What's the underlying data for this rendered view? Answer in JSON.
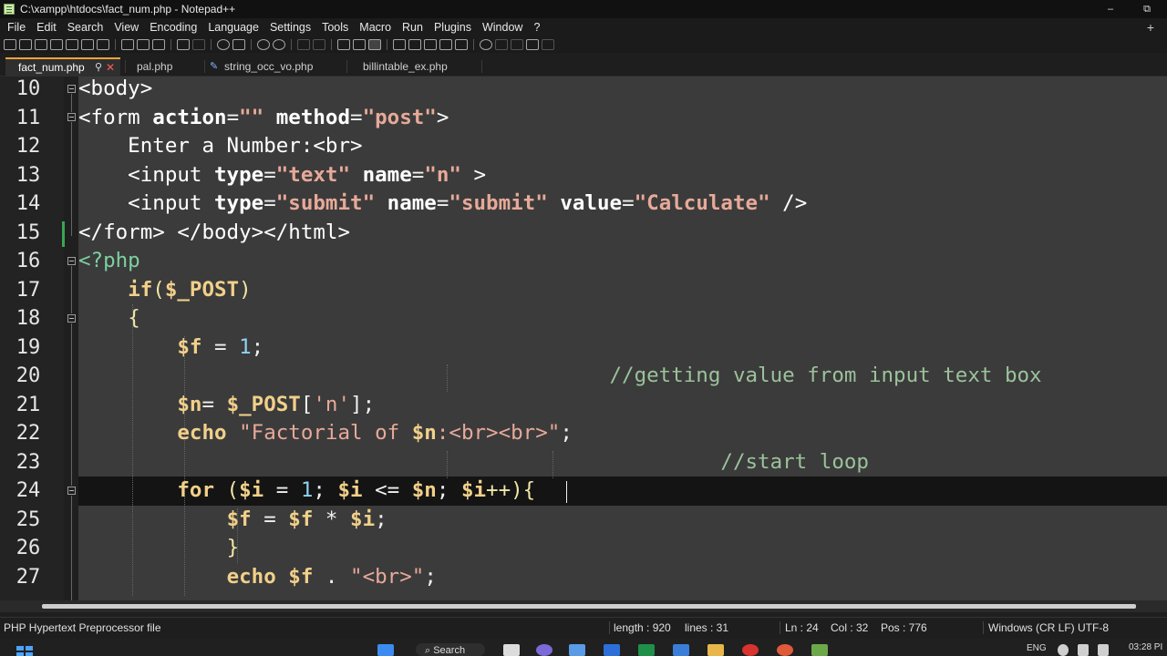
{
  "window": {
    "title": "C:\\xampp\\htdocs\\fact_num.php - Notepad++",
    "minimize": "–",
    "restore": "⧉"
  },
  "menu": [
    "File",
    "Edit",
    "Search",
    "View",
    "Encoding",
    "Language",
    "Settings",
    "Tools",
    "Macro",
    "Run",
    "Plugins",
    "Window",
    "?"
  ],
  "menu_plus": "+",
  "toolbar_icons": [
    "new-file-icon",
    "open-file-icon",
    "save-icon",
    "save-all-icon",
    "close-icon",
    "close-all-icon",
    "print-icon",
    "cut-icon",
    "copy-icon",
    "paste-icon",
    "undo-icon",
    "redo-icon",
    "find-icon",
    "replace-icon",
    "zoom-in-icon",
    "zoom-out-icon",
    "sync-vertical-icon",
    "sync-horizontal-icon",
    "word-wrap-icon",
    "show-all-chars-icon",
    "indent-guide-icon",
    "define-language-icon",
    "document-map-icon",
    "function-list-icon",
    "folder-workspace-icon",
    "monitoring-icon",
    "record-macro-icon",
    "stop-record-icon",
    "play-macro-icon",
    "run-macro-multiple-icon",
    "save-macro-icon"
  ],
  "tabs": [
    {
      "label": "fact_num.php",
      "active": true
    },
    {
      "label": "pal.php",
      "active": false
    },
    {
      "label": "string_occ_vo.php",
      "active": false
    },
    {
      "label": "billintable_ex.php",
      "active": false
    }
  ],
  "line_numbers": [
    "10",
    "11",
    "12",
    "13",
    "14",
    "15",
    "16",
    "17",
    "18",
    "19",
    "20",
    "21",
    "22",
    "23",
    "24",
    "25",
    "26",
    "27"
  ],
  "code": {
    "l10": "<body>",
    "l11_open": "<form ",
    "l11_action": "action",
    "l11_eq1": "=",
    "l11_actionval": "\"\"",
    "l11_method": "method",
    "l11_eq2": "=",
    "l11_methodval": "\"post\"",
    "l11_close": ">",
    "l12": "    Enter a Number:<br>",
    "l13_open": "    <input ",
    "l13_type": "type",
    "l13_eq1": "=",
    "l13_typeval": "\"text\"",
    "l13_name": "name",
    "l13_eq2": "=",
    "l13_nameval": "\"n\"",
    "l13_close": " >",
    "l14_open": "    <input ",
    "l14_type": "type",
    "l14_eq1": "=",
    "l14_typeval": "\"submit\"",
    "l14_name": "name",
    "l14_eq2": "=",
    "l14_nameval": "\"submit\"",
    "l14_value": "value",
    "l14_eq3": "=",
    "l14_valueval": "\"Calculate\"",
    "l14_close": " />",
    "l15": "</form> </body></html>",
    "l16": "<?php",
    "l17_if": "if",
    "l17_paren": "(",
    "l17_var": "$_POST",
    "l17_close": ")",
    "l18": "{",
    "l19_var": "$f",
    "l19_op": " = ",
    "l19_num": "1",
    "l19_end": ";",
    "l20": "//getting value from input text box",
    "l21_var": "$n",
    "l21_op": "= ",
    "l21_post": "$_POST",
    "l21_br": "[",
    "l21_key": "'n'",
    "l21_end": "];",
    "l22_echo": "echo",
    "l22_str1": "\"Factorial of ",
    "l22_var": "$n",
    "l22_str2": ":<br><br>\"",
    "l22_end": ";",
    "l23": "//start loop",
    "l24_for": "for",
    "l24_p1": " (",
    "l24_v1": "$i",
    "l24_op1": " = ",
    "l24_n1": "1",
    "l24_semi1": "; ",
    "l24_v2": "$i",
    "l24_op2": " <= ",
    "l24_v3": "$n",
    "l24_semi2": "; ",
    "l24_v4": "$i",
    "l24_inc": "++){",
    "l25_v1": "$f",
    "l25_op1": " = ",
    "l25_v2": "$f",
    "l25_op2": " * ",
    "l25_v3": "$i",
    "l25_end": ";",
    "l26": "}",
    "l27_echo": "echo",
    "l27_var": "$f",
    "l27_dot": " . ",
    "l27_str": "\"<br>\"",
    "l27_end": ";"
  },
  "status": {
    "filetype": "PHP Hypertext Preprocessor file",
    "length": "length : 920",
    "lines": "lines : 31",
    "ln": "Ln : 24",
    "col": "Col : 32",
    "pos": "Pos : 776",
    "eol_enc": "Windows (CR LF)  UTF-8"
  },
  "taskbar": {
    "search": "Search",
    "lang": "ENG",
    "time": "03:28 PI"
  }
}
